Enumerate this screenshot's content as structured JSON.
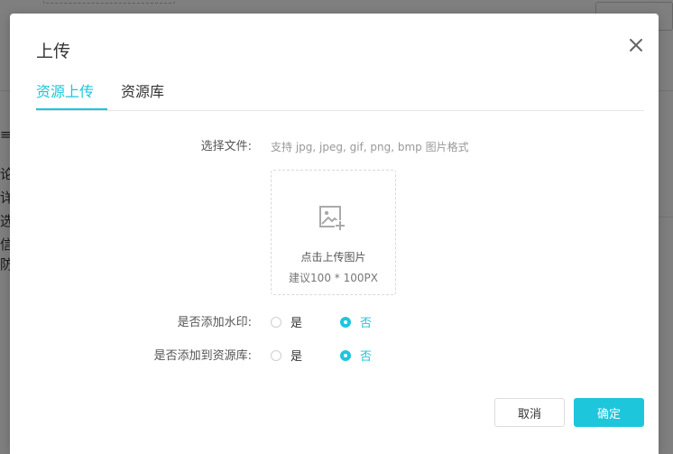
{
  "background": {
    "side_glyphs": [
      "≡",
      "论",
      "详",
      "选",
      "信",
      "防"
    ]
  },
  "modal": {
    "title": "上传",
    "tabs": [
      {
        "label": "资源上传",
        "active": true
      },
      {
        "label": "资源库",
        "active": false
      }
    ],
    "file_field": {
      "label": "选择文件:",
      "hint": "支持 jpg, jpeg, gif, png, bmp 图片格式"
    },
    "upload_box": {
      "icon": "image-add-icon",
      "text": "点击上传图片",
      "subtext": "建议100 * 100PX"
    },
    "watermark": {
      "label": "是否添加水印:",
      "options": [
        {
          "label": "是",
          "checked": false
        },
        {
          "label": "否",
          "checked": true
        }
      ]
    },
    "add_to_library": {
      "label": "是否添加到资源库:",
      "options": [
        {
          "label": "是",
          "checked": false
        },
        {
          "label": "否",
          "checked": true
        }
      ]
    },
    "buttons": {
      "cancel": "取消",
      "confirm": "确定"
    }
  },
  "colors": {
    "accent": "#1ec6db",
    "overlay": "rgba(0,0,0,0.5)"
  }
}
